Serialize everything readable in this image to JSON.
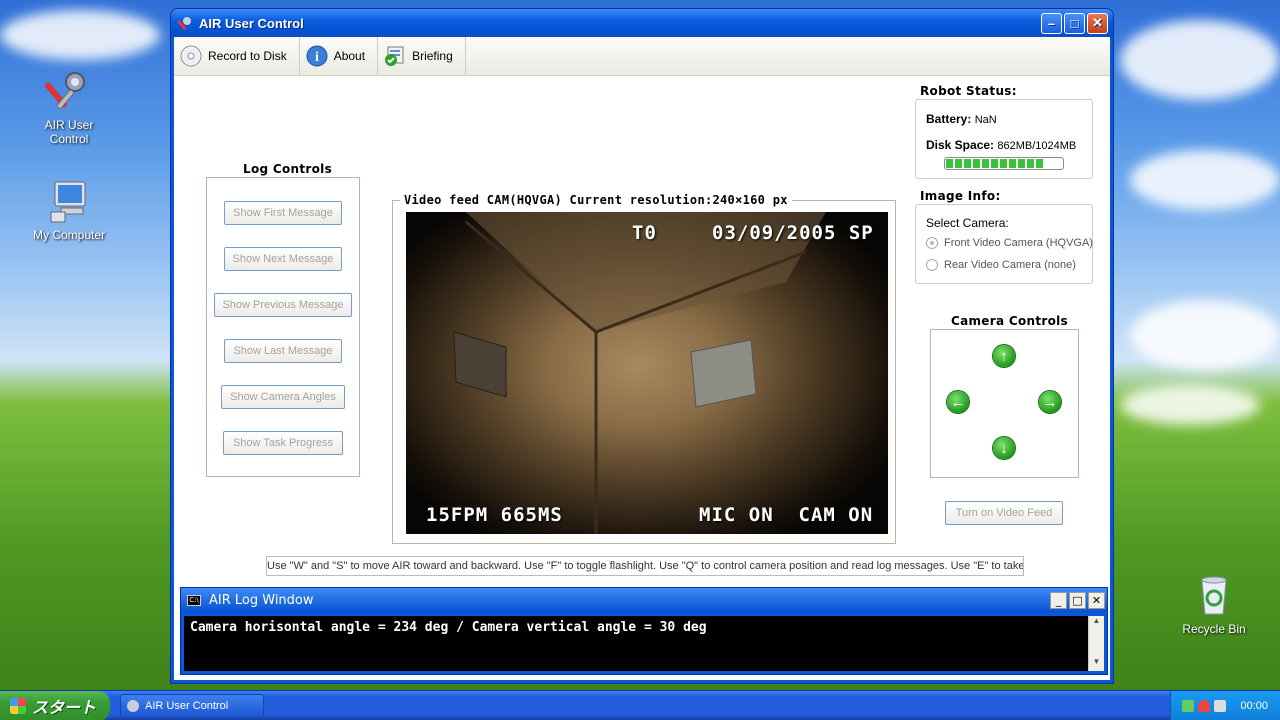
{
  "desktop": {
    "icons": [
      {
        "label_1": "AIR User",
        "label_2": "Control"
      },
      {
        "label": "My Computer"
      },
      {
        "label": "Recycle Bin"
      }
    ]
  },
  "window": {
    "title": "AIR User Control",
    "toolbar": {
      "record_label": "Record to Disk",
      "about_label": "About",
      "briefing_label": "Briefing"
    },
    "log_controls": {
      "title": "Log Controls",
      "buttons": [
        "Show First Message",
        "Show Next Message",
        "Show Previous Message",
        "Show Last Message",
        "Show Camera Angles",
        "Show Task Progress"
      ]
    },
    "video": {
      "title": "Video feed CAM(HQVGA) Current resolution:240×160 px",
      "osd_top_left": "T0",
      "osd_top_right": "03/09/2005 SP",
      "osd_bottom_left": "15FPM 665MS",
      "osd_bottom_right": "MIC ON  CAM ON"
    },
    "robot_status": {
      "title": "Robot Status:",
      "battery_label": "Battery:",
      "battery_value": "NaN",
      "disk_label": "Disk Space:",
      "disk_value": "862MB/1024MB",
      "disk_fraction": 0.84
    },
    "image_info": {
      "title": "Image Info:",
      "select_label": "Select Camera:",
      "options": [
        "Front Video Camera (HQVGA)",
        "Rear Video Camera (none)"
      ],
      "selected_index": 0
    },
    "camera_controls": {
      "title": "Camera Controls",
      "video_button": "Turn on Video Feed"
    },
    "hint": "Use \"W\" and \"S\" to move AIR toward and backward. Use \"F\" to toggle flashlight. Use \"Q\" to control camera position and read log messages. Use \"E\" to take photos.",
    "log_window": {
      "title": "AIR Log Window",
      "message": "Camera horisontal angle = 234 deg / Camera vertical angle = 30 deg"
    }
  },
  "taskbar": {
    "start_label": "スタート",
    "task_label": "AIR User Control",
    "clock": "00:00"
  },
  "colors": {
    "accent": "#0a57d8",
    "progress": "#37c23a",
    "arrow": "#1f9a1c"
  }
}
